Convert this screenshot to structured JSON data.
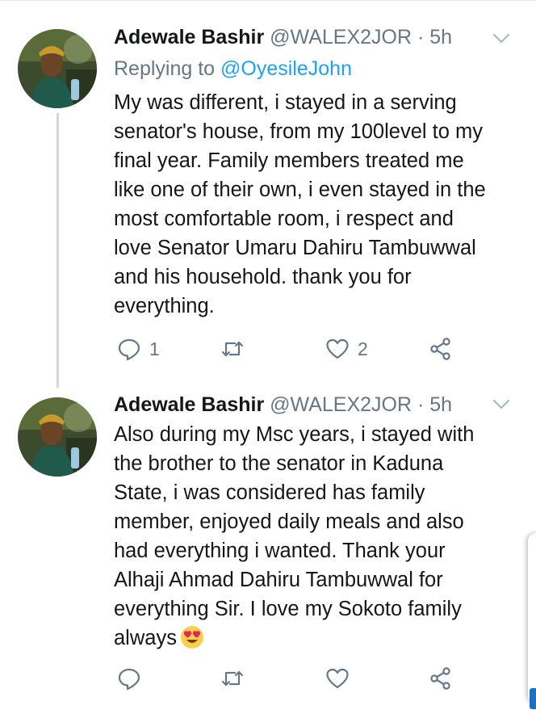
{
  "tweets": [
    {
      "author_name": "Adewale Bashir",
      "handle": "@WALEX2JOR",
      "separator": "·",
      "time": "5h",
      "replying_prefix": "Replying to",
      "replying_to": "@OyesileJohn",
      "text": "My was different, i stayed in a serving\nsenator's house, from my 100level to my\nfinal year. Family members treated me\nlike one of their own, i even stayed in the\nmost comfortable room, i respect and\nlove Senator Umaru Dahiru Tambuwwal\nand his household. thank you for\neverything.",
      "reply_count": "1",
      "retweet_count": "",
      "like_count": "2"
    },
    {
      "author_name": "Adewale Bashir",
      "handle": "@WALEX2JOR",
      "separator": "·",
      "time": "5h",
      "text": "Also during my Msc years, i stayed with\nthe brother to the senator in Kaduna\nState, i was considered has family\nmember, enjoyed daily meals and also\nhad everything i wanted. Thank your\nAlhaji Ahmad Dahiru Tambuwwal for\neverything Sir. I love my Sokoto family\nalways",
      "emoji": "heart-eyes",
      "reply_count": "",
      "retweet_count": "",
      "like_count": ""
    }
  ],
  "icons": [
    "reply-icon",
    "retweet-icon",
    "like-icon",
    "share-icon",
    "chevron-down-icon"
  ],
  "colors": {
    "name": "#14171a",
    "muted": "#657786",
    "link": "#1da1f2",
    "thread_line": "#cfd9de"
  }
}
